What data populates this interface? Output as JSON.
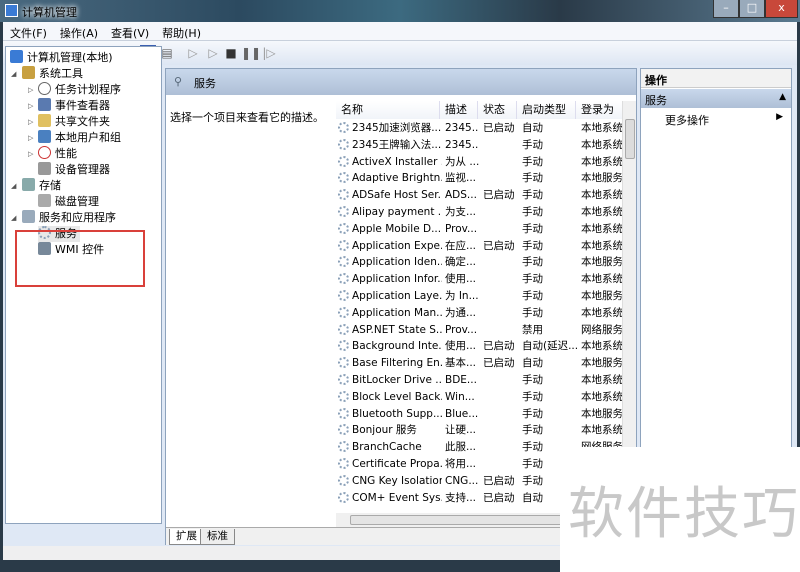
{
  "window": {
    "title": "计算机管理",
    "min": "–",
    "max": "□",
    "close": "x"
  },
  "menu": [
    "文件(F)",
    "操作(A)",
    "查看(V)",
    "帮助(H)"
  ],
  "tree": {
    "root": "计算机管理(本地)",
    "system_tools": "系统工具",
    "system_children": [
      "任务计划程序",
      "事件查看器",
      "共享文件夹",
      "本地用户和组",
      "性能",
      "设备管理器"
    ],
    "storage": "存储",
    "disk": "磁盘管理",
    "services_apps": "服务和应用程序",
    "services": "服务",
    "wmi": "WMI 控件"
  },
  "middle": {
    "header": "服务",
    "description": "选择一个项目来查看它的描述。",
    "columns": [
      "名称",
      "描述",
      "状态",
      "启动类型",
      "登录为"
    ],
    "rows": [
      [
        "2345加速浏览器...",
        "2345...",
        "已启动",
        "自动",
        "本地系统"
      ],
      [
        "2345王牌输入法...",
        "2345...",
        "",
        "手动",
        "本地系统"
      ],
      [
        "ActiveX Installer ...",
        "为从 ...",
        "",
        "手动",
        "本地系统"
      ],
      [
        "Adaptive Brightn...",
        "监视...",
        "",
        "手动",
        "本地服务"
      ],
      [
        "ADSafe Host Ser...",
        "ADS...",
        "已启动",
        "手动",
        "本地系统"
      ],
      [
        "Alipay payment ...",
        "为支...",
        "",
        "手动",
        "本地系统"
      ],
      [
        "Apple Mobile D...",
        "Prov...",
        "",
        "手动",
        "本地系统"
      ],
      [
        "Application Expe...",
        "在应...",
        "已启动",
        "手动",
        "本地系统"
      ],
      [
        "Application Iden...",
        "确定...",
        "",
        "手动",
        "本地服务"
      ],
      [
        "Application Infor...",
        "使用...",
        "",
        "手动",
        "本地系统"
      ],
      [
        "Application Laye...",
        "为 In...",
        "",
        "手动",
        "本地服务"
      ],
      [
        "Application Man...",
        "为通...",
        "",
        "手动",
        "本地系统"
      ],
      [
        "ASP.NET State S...",
        "Prov...",
        "",
        "禁用",
        "网络服务"
      ],
      [
        "Background Inte...",
        "使用...",
        "已启动",
        "自动(延迟...",
        "本地系统"
      ],
      [
        "Base Filtering En...",
        "基本...",
        "已启动",
        "自动",
        "本地服务"
      ],
      [
        "BitLocker Drive ...",
        "BDE...",
        "",
        "手动",
        "本地系统"
      ],
      [
        "Block Level Back...",
        "Win...",
        "",
        "手动",
        "本地系统"
      ],
      [
        "Bluetooth Supp...",
        "Blue...",
        "",
        "手动",
        "本地服务"
      ],
      [
        "Bonjour 服务",
        "让硬...",
        "",
        "手动",
        "本地系统"
      ],
      [
        "BranchCache",
        "此服...",
        "",
        "手动",
        "网络服务"
      ],
      [
        "Certificate Propa...",
        "将用...",
        "",
        "手动",
        ""
      ],
      [
        "CNG Key Isolation",
        "CNG...",
        "已启动",
        "手动",
        ""
      ],
      [
        "COM+ Event Sys...",
        "支持...",
        "已启动",
        "自动",
        ""
      ]
    ],
    "tabs": [
      "扩展",
      "标准"
    ]
  },
  "actions": {
    "header": "操作",
    "section": "服务",
    "more": "更多操作"
  },
  "watermark": "软件技巧"
}
